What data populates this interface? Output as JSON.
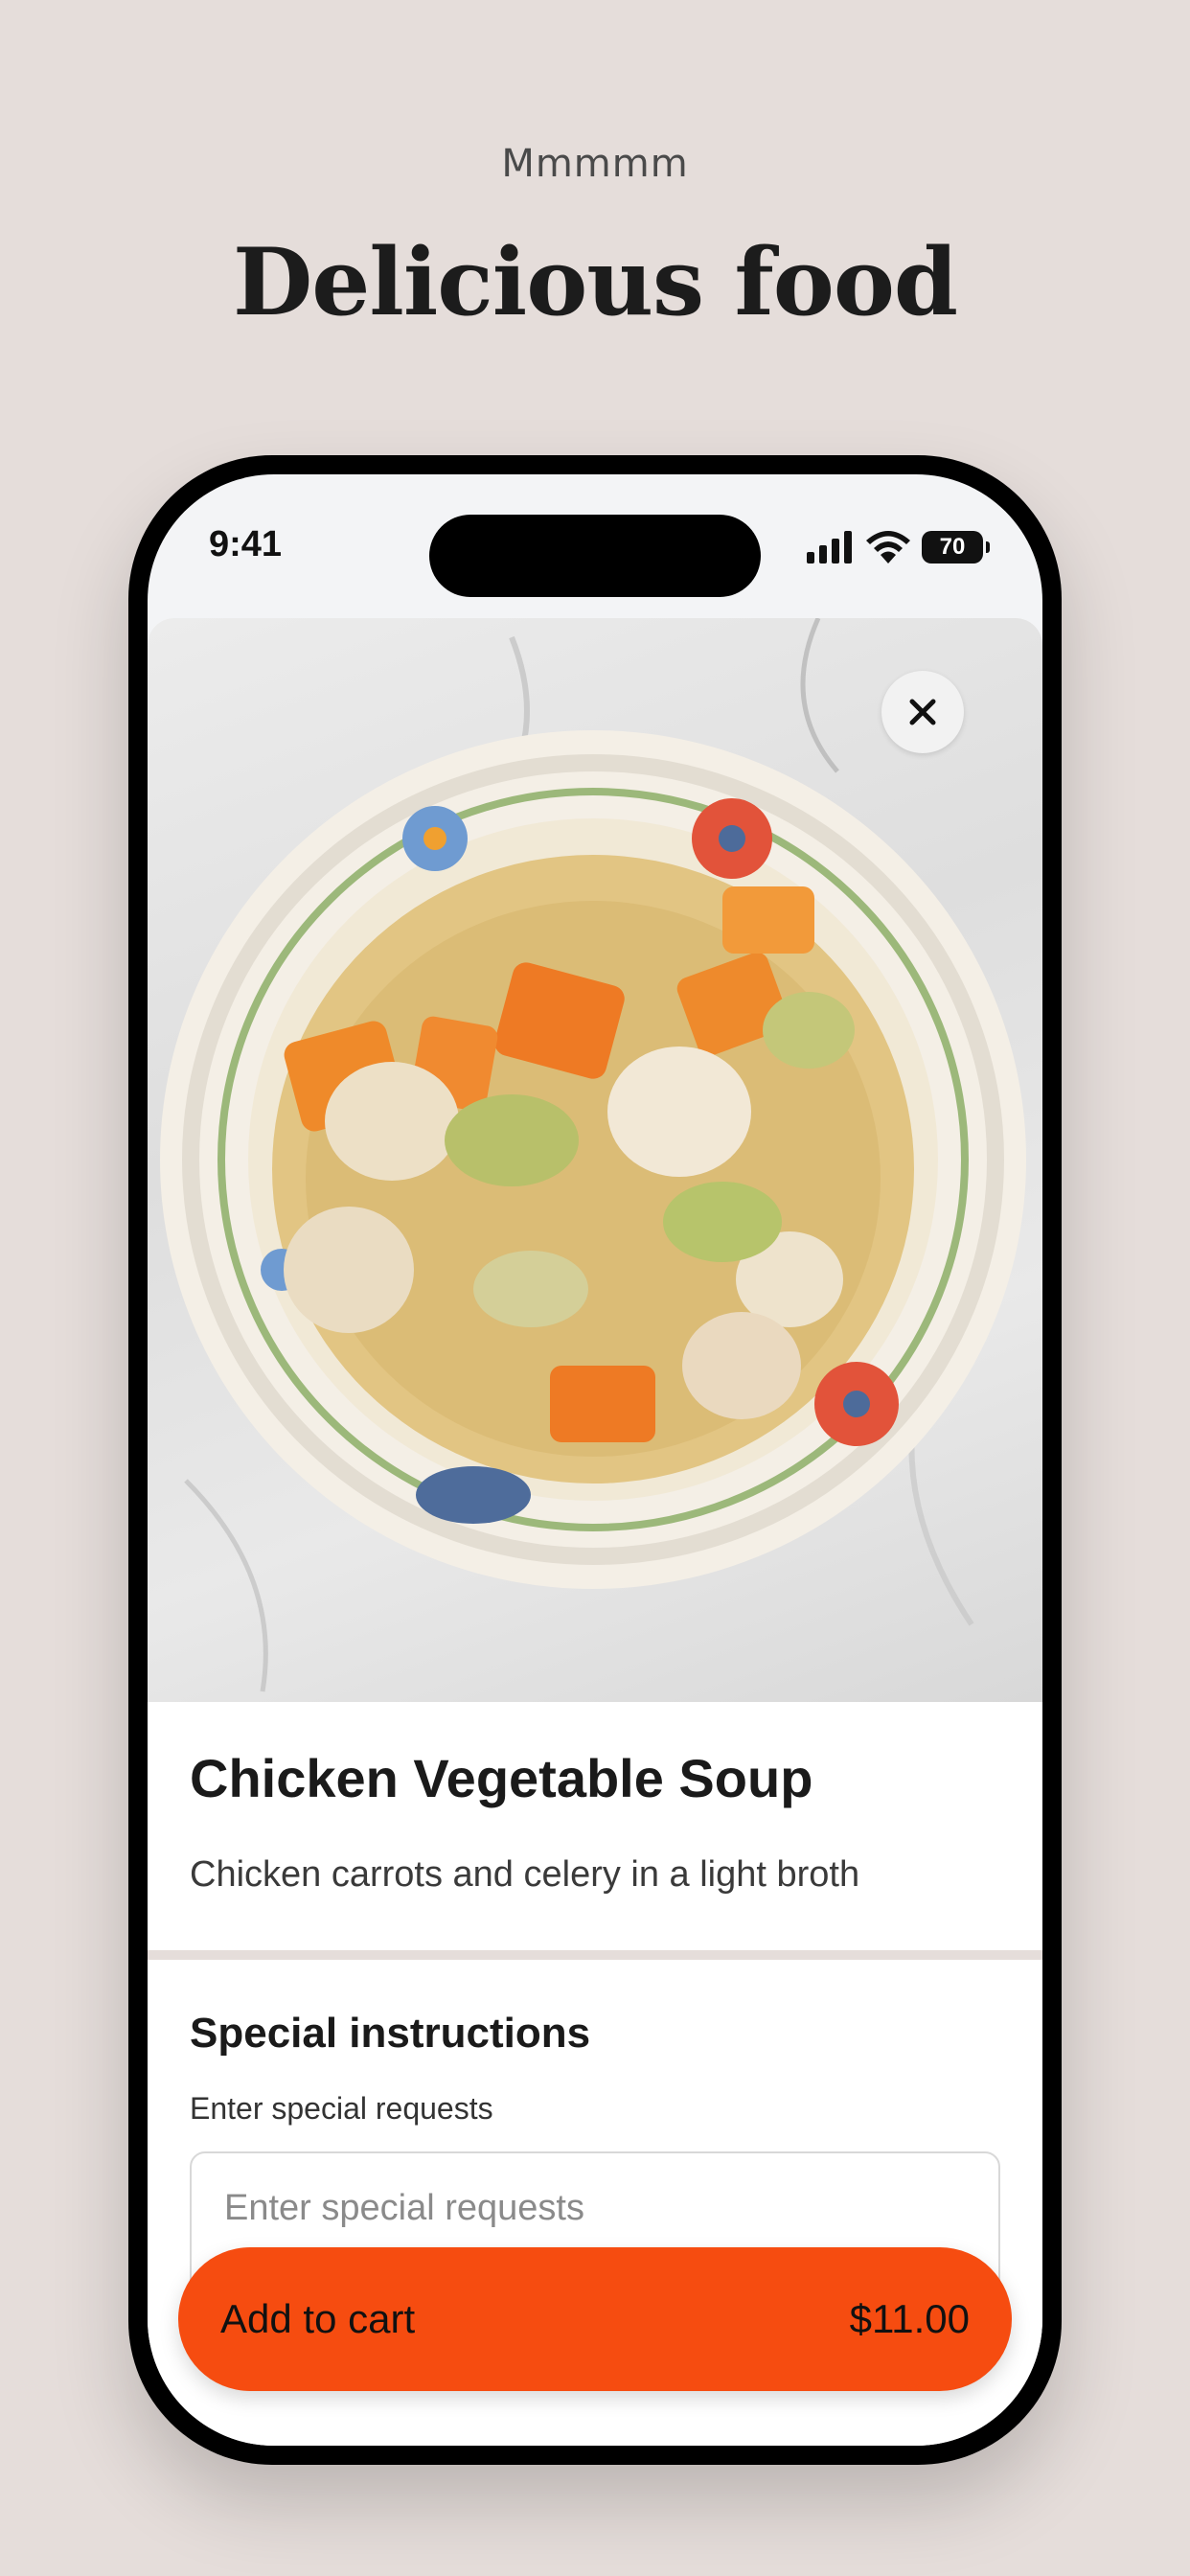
{
  "header": {
    "eyebrow": "Mmmmm",
    "headline": "Delicious food"
  },
  "status_bar": {
    "time": "9:41",
    "battery": "70",
    "icons": [
      "cellular-signal-icon",
      "wifi-icon",
      "battery-icon"
    ]
  },
  "item": {
    "image": "chicken-vegetable-soup-photo",
    "close_icon": "close-icon",
    "name": "Chicken Vegetable Soup",
    "description": "Chicken carrots and celery in a light broth"
  },
  "special_instructions": {
    "title": "Special instructions",
    "label": "Enter special requests",
    "placeholder": "Enter special requests"
  },
  "cart": {
    "label": "Add to cart",
    "price": "$11.00"
  },
  "colors": {
    "background": "#e5ddda",
    "accent": "#f64c10",
    "text": "#1a1a1a"
  }
}
